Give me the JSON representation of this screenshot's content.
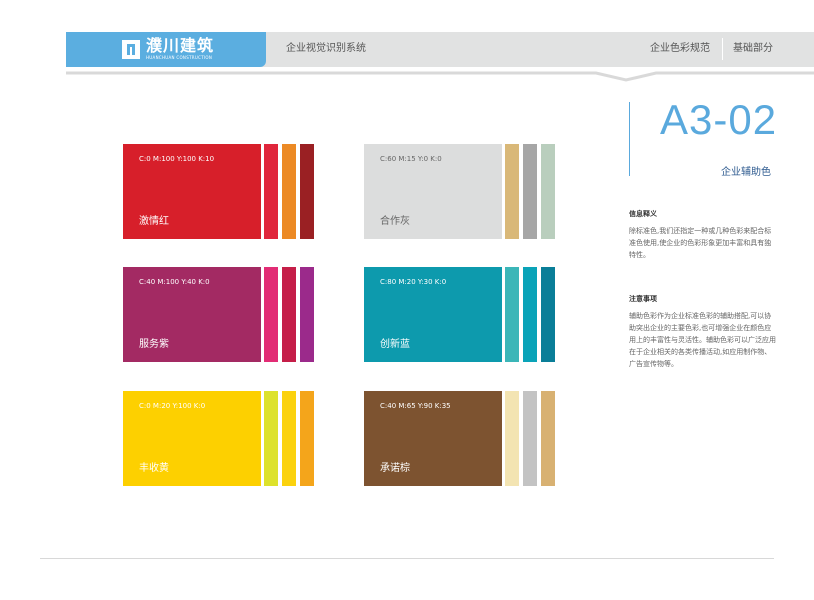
{
  "header": {
    "logo_text": "濮川建筑",
    "logo_subtitle": "HUANCHUAN CONSTRUCTION",
    "system_title": "企业视觉识别系统",
    "nav": [
      "企业色彩规范",
      "基础部分"
    ]
  },
  "page": {
    "code": "A3-02",
    "section_title": "企业辅助色"
  },
  "info": {
    "title_1": "信息释义",
    "text_1": "除标准色,我们还指定一种或几种色彩来配合标准色使用,使企业的色彩形象更加丰富和具有独特性。",
    "title_2": "注意事项",
    "text_2": "辅助色彩作为企业标准色彩的辅助搭配,可以协助突出企业的主要色彩,也可增强企业在颜色应用上的丰富性与灵活性。辅助色彩可以广泛应用在于企业相关的各类传播活动,如应用制作物、广告宣传物等。"
  },
  "swatches": [
    {
      "name": "激情红",
      "cmyk": "C:0  M:100  Y:100  K:10",
      "main": "#d71f2a",
      "strips": [
        "#e0263c",
        "#ec8a25",
        "#9a2023"
      ]
    },
    {
      "name": "合作灰",
      "cmyk": "C:60  M:15  Y:0  K:0",
      "main": "#dcdddd",
      "strips": [
        "#d9b878",
        "#a6a6a6",
        "#b9cebd"
      ]
    },
    {
      "name": "服务紫",
      "cmyk": "C:40  M:100  Y:40  K:0",
      "main": "#a32a63",
      "strips": [
        "#e22c75",
        "#c51e48",
        "#9b2a8b"
      ]
    },
    {
      "name": "创新蓝",
      "cmyk": "C:80  M:20  Y:30  K:0",
      "main": "#0d9aad",
      "strips": [
        "#3bb6b8",
        "#0aa3b8",
        "#0a7e98"
      ]
    },
    {
      "name": "丰收黄",
      "cmyk": "C:0  M:20  Y:100  K:0",
      "main": "#fdd000",
      "strips": [
        "#dde22c",
        "#fbd20e",
        "#f4a51b"
      ]
    },
    {
      "name": "承诺棕",
      "cmyk": "C:40  M:65  Y:90  K:35",
      "main": "#7d5330",
      "strips": [
        "#f3e4b2",
        "#c3c3c3",
        "#d8b172"
      ]
    }
  ],
  "colors": {
    "brand_blue": "#5baee0",
    "header_gray": "#e1e2e2",
    "title_navy": "#2d5a8f"
  }
}
